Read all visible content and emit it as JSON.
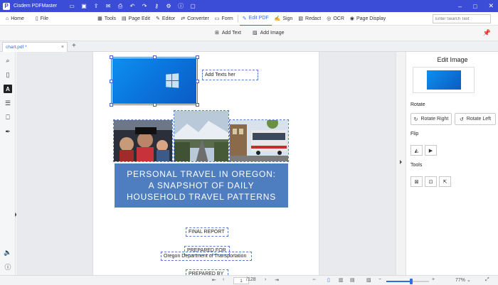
{
  "app": {
    "logo_letter": "P",
    "name": "Cisdem PDFMaster"
  },
  "titlebar_icons": [
    "folder-icon",
    "save-icon",
    "share-icon",
    "mail-icon",
    "print-icon",
    "undo-icon",
    "redo-icon",
    "key-icon",
    "settings-icon",
    "info-icon",
    "chat-icon"
  ],
  "menu": {
    "home": "Home",
    "file": "File",
    "tools": "Tools",
    "page_edit": "Page Edit",
    "editor": "Editor",
    "converter": "Converter",
    "form": "Form",
    "edit_pdf": "Edit PDF",
    "sign": "Sign",
    "redact": "Redact",
    "ocr": "OCR",
    "page_display": "Page Display"
  },
  "search": {
    "placeholder": "Enter Search Text"
  },
  "subtoolbar": {
    "add_text": "Add Text",
    "add_image": "Add Image"
  },
  "tab": {
    "name": "chart.pdf *"
  },
  "document": {
    "text_box_1": "Add Texts her",
    "banner_lines": [
      "PERSONAL TRAVEL IN OREGON:",
      "A SNAPSHOT OF DAILY",
      "HOUSEHOLD TRAVEL PATTERNS"
    ],
    "final_report": "FINAL REPORT",
    "prepared_for": "PREPARED FOR",
    "odot": "Oregon Department of Transportation",
    "prepared_by": "PREPARED BY"
  },
  "panel": {
    "title": "Edit Image",
    "rotate_label": "Rotate",
    "rotate_right": "Rotate Right",
    "rotate_left": "Rotate Left",
    "flip_label": "Flip",
    "tools_label": "Tools"
  },
  "status": {
    "current_page": "1",
    "total_pages": "/128",
    "zoom": "77%",
    "zoom_fraction": 0.58
  },
  "colors": {
    "titlebar": "#3b4dd6",
    "accent": "#2f6fe0",
    "banner": "#4e7ec0"
  }
}
